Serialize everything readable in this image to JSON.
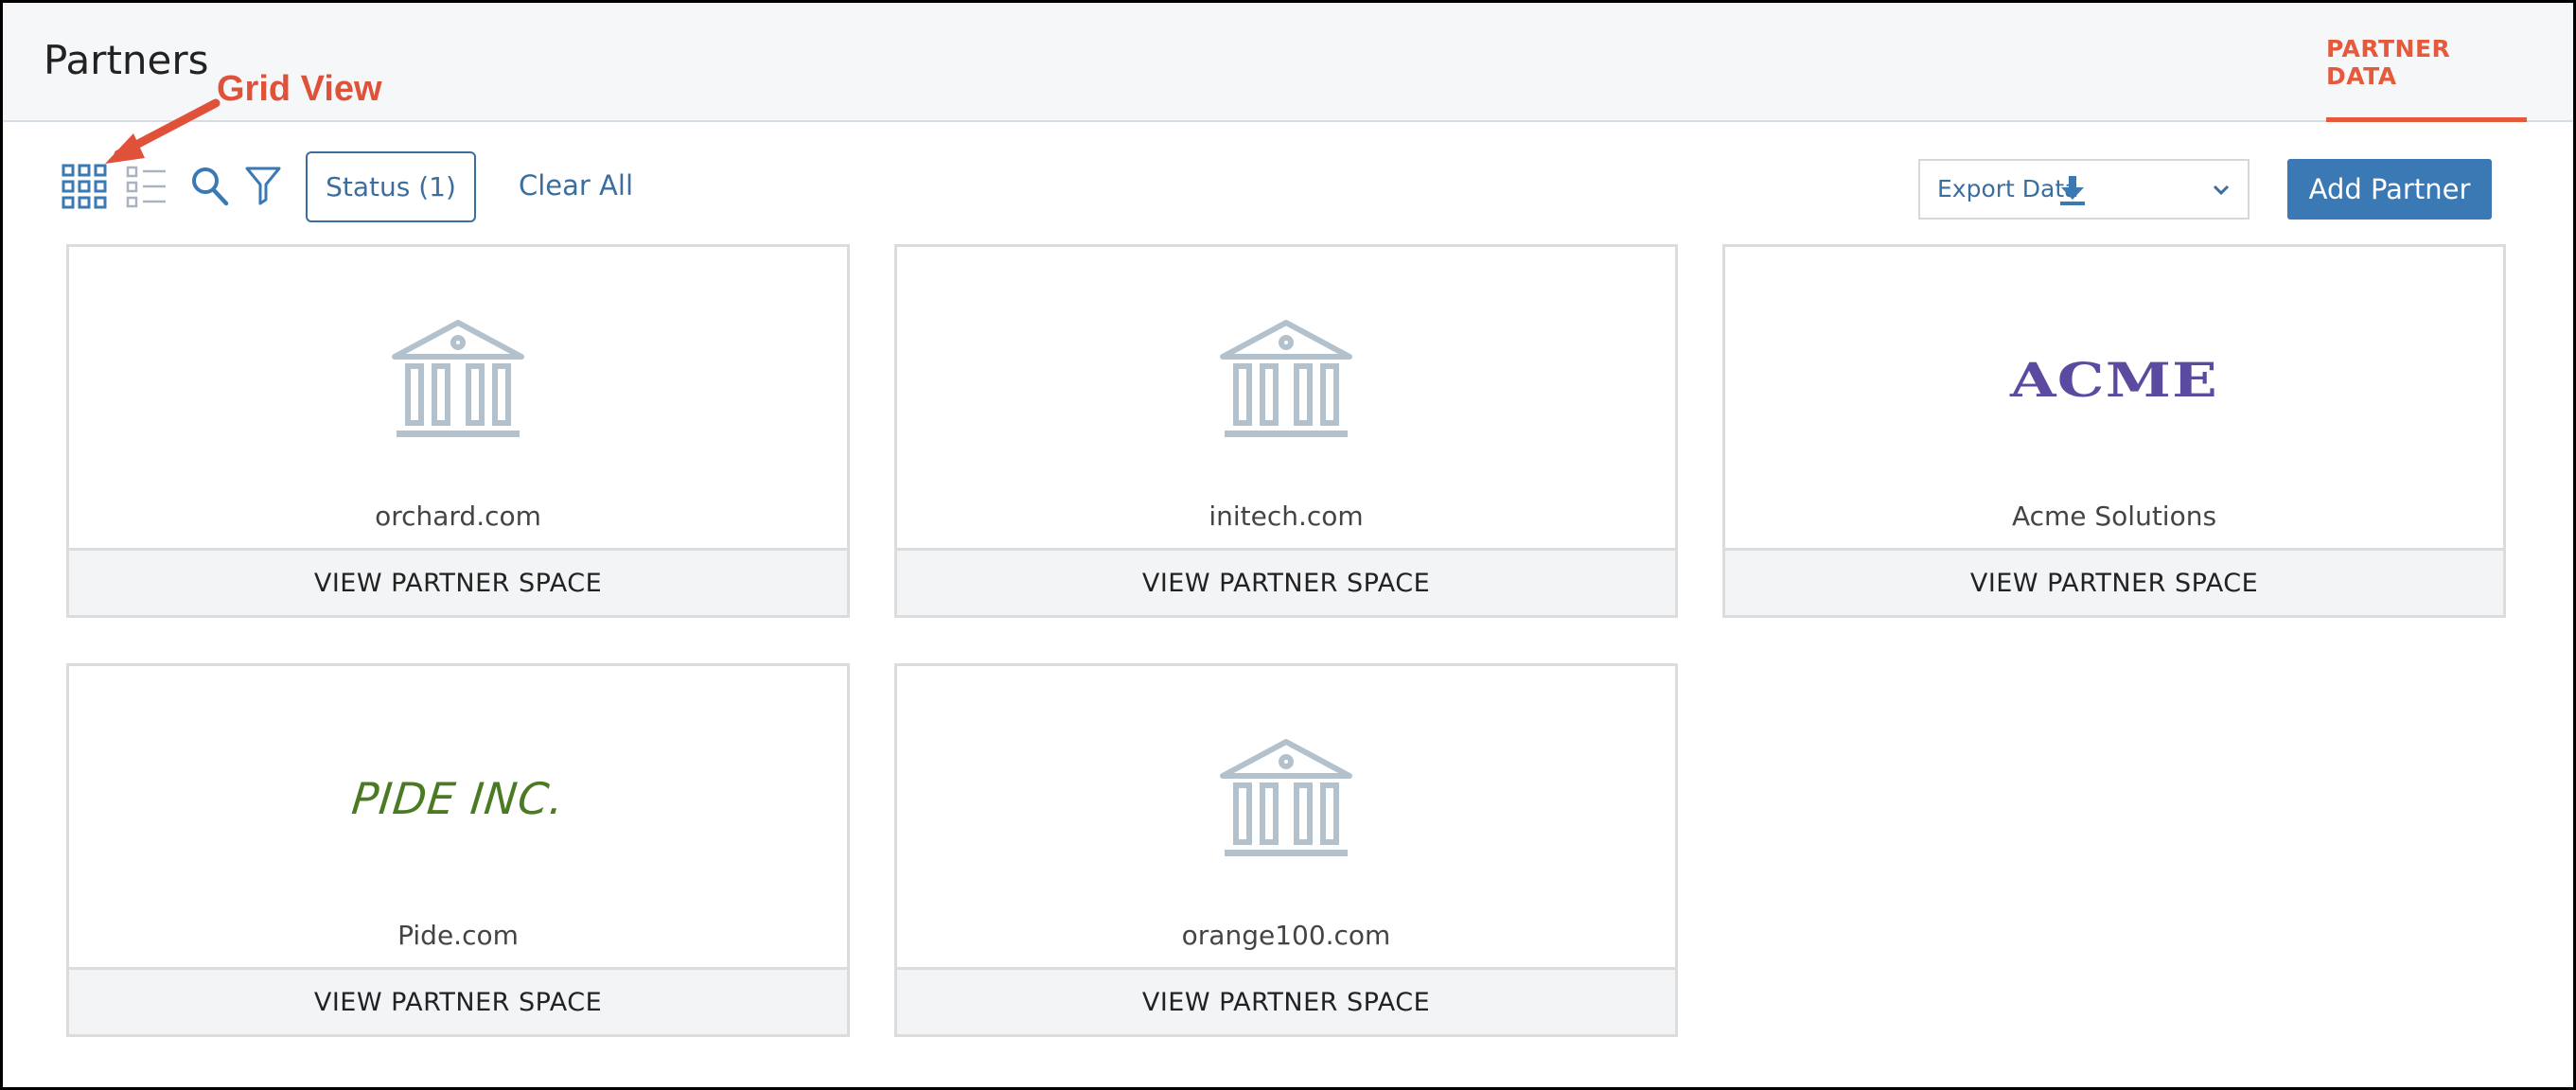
{
  "header": {
    "title": "Partners",
    "tab_label": "PARTNER DATA"
  },
  "annotation": {
    "label": "Grid View"
  },
  "toolbar": {
    "status_filter_label": "Status (1)",
    "clear_all_label": "Clear All",
    "export_label": "Export Data",
    "add_partner_label": "Add Partner"
  },
  "partners": [
    {
      "name": "orchard.com",
      "logo": "bank-icon",
      "action": "VIEW PARTNER SPACE"
    },
    {
      "name": "initech.com",
      "logo": "bank-icon",
      "action": "VIEW PARTNER SPACE"
    },
    {
      "name": "Acme Solutions",
      "logo_text": "ACME",
      "action": "VIEW PARTNER SPACE"
    },
    {
      "name": "Pide.com",
      "logo_text": "PIDE INC.",
      "action": "VIEW PARTNER SPACE"
    },
    {
      "name": "orange100.com",
      "logo": "bank-icon",
      "action": "VIEW PARTNER SPACE"
    }
  ],
  "colors": {
    "accent": "#e55a3c",
    "primary": "#3b79b5",
    "icon_gray": "#b3c1cd",
    "acme_purple": "#5b4aa0",
    "pide_green": "#4a7a22"
  }
}
